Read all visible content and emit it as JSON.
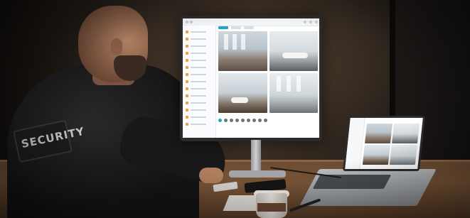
{
  "scene": {
    "patch_text": "SECURITY",
    "monitor": {
      "app": "camera-monitoring",
      "sidebar_item_count": 14,
      "camera_feeds": [
        "cam-1",
        "cam-2",
        "cam-3",
        "cam-4"
      ]
    },
    "laptop": {
      "camera_feeds": [
        "cam-1",
        "cam-2",
        "cam-3",
        "cam-4"
      ]
    }
  },
  "colors": {
    "accent": "#1ea7c7",
    "sidebar_icon": "#f39b3a",
    "desk": "#7b5638"
  }
}
